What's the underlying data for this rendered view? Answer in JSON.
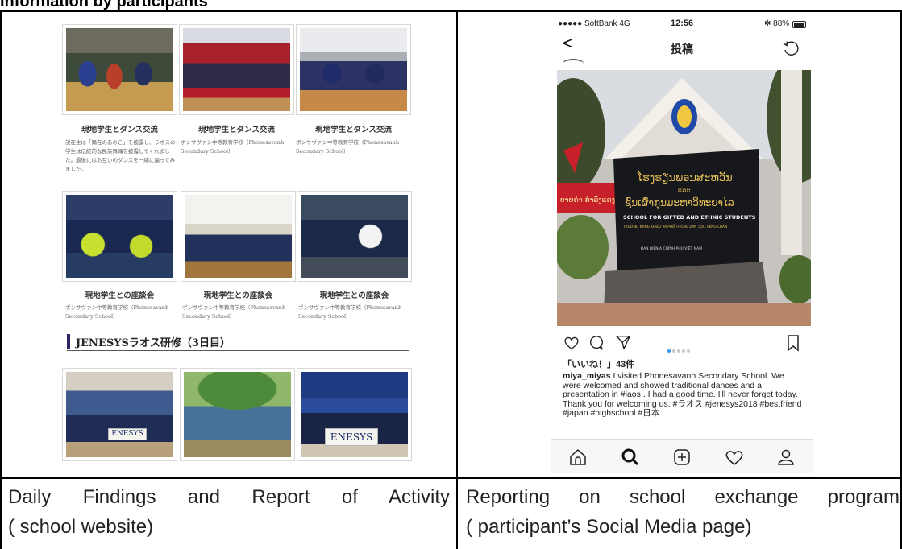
{
  "heading": "Information by participants",
  "website": {
    "row1": [
      {
        "title": "現地学生とダンス交流",
        "desc": "説在生は「踊在のあのこ」を披露し、ラオスの学生は伝統的な民族舞踊を披露してくれました。最後にはお互いのダンスを一緒に踊ってみました。"
      },
      {
        "title": "現地学生とダンス交流",
        "desc": "ポンサヴァン中等教育学校（Phonesavanh Secondary School）"
      },
      {
        "title": "現地学生とダンス交流",
        "desc": "ポンサヴァン中等教育学校（Phonesavanh Secondary School）"
      }
    ],
    "row2": [
      {
        "title": "現地学生との座談会",
        "desc": "ポンサヴァン中等教育学校（Phonesavanh Secondary School）"
      },
      {
        "title": "現地学生との座談会",
        "desc": "ポンサヴァン中等教育学校（Phonesavanh Secondary School）"
      },
      {
        "title": "現地学生との座談会",
        "desc": "ポンサヴァン中等教育学校（Phonesavanh Secondary School）"
      }
    ],
    "section_heading": "JENESYSラオス研修（3日目）",
    "banner_text": "ENESYS"
  },
  "phone": {
    "carrier": "●●●●● SoftBank  4G",
    "time": "12:56",
    "battery": "✻ 88%",
    "back": "<",
    "title": "投稿",
    "sign": {
      "line1": "ໂຮງຮຽນພອນສະຫວັນ",
      "line2": "ແລະ",
      "line3": "ຊົນເຜົ່າກຸນມະຫາວິທະຍາໄລ",
      "line4": "SCHOOL FOR GIFTED AND ETHNIC STUDENTS",
      "line5": "TRƯỜNG NĂNG KHIẾU VÀ PHỔ THÔNG DÂN TỘC TIẾNG CHÂN",
      "line6": "BAN BIÊN  A CHÍNH PHỦ VIỆT NAM",
      "red_banner": "ບາຍຄຳ ກຳລັງແດງ ສົນຄະນານ"
    },
    "likes": "「いいね！」43件",
    "username": "miya_miyas",
    "caption": " I visited Phonesavanh Secondary School. We were welcomed and showed traditional dances and a presentation in #laos . I had a good time. I'll never forget today. Thank you for welcoming us. #ラオス #jenesys2018 #bestfriend #japan #highschool #日本"
  },
  "captions": {
    "left_line1": "Daily Findings and Report of Activity",
    "left_line2": "( school website)",
    "right_line1": "Reporting on school exchange program",
    "right_line2": "( participant’s Social Media page)"
  },
  "colors": {
    "section_bar": "#2b2466",
    "ios_blue": "#3897f0"
  }
}
